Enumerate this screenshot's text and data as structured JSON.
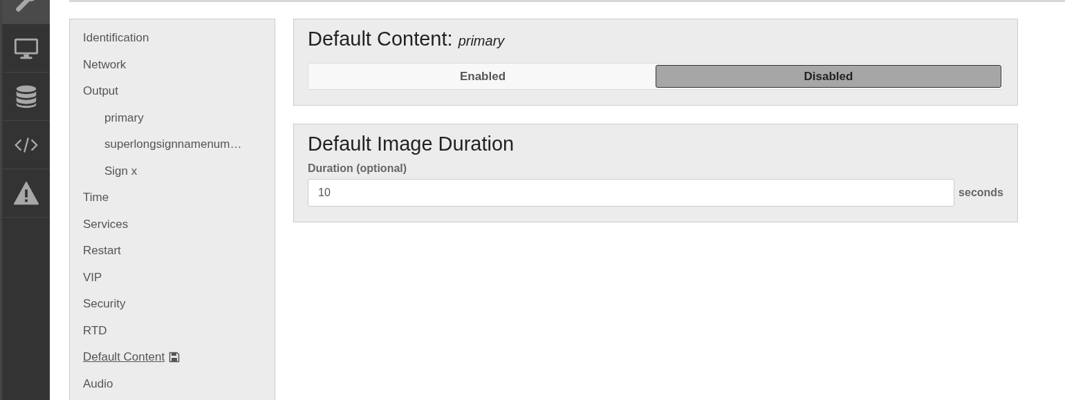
{
  "icon_bar": [
    {
      "kind": "wrench",
      "selected": true
    },
    {
      "kind": "monitor",
      "selected": false
    },
    {
      "kind": "database",
      "selected": false
    },
    {
      "kind": "code",
      "selected": false
    },
    {
      "kind": "warning",
      "selected": false
    }
  ],
  "sidebar": {
    "items": [
      {
        "label": "Identification",
        "selected": false
      },
      {
        "label": "Network",
        "selected": false
      },
      {
        "label": "Output",
        "selected": false,
        "children": [
          {
            "label": "primary",
            "selected": false
          },
          {
            "label": "superlongsignnamenum…",
            "selected": false
          },
          {
            "label": "Sign x",
            "selected": false
          }
        ]
      },
      {
        "label": "Time",
        "selected": false
      },
      {
        "label": "Services",
        "selected": false
      },
      {
        "label": "Restart",
        "selected": false
      },
      {
        "label": "VIP",
        "selected": false
      },
      {
        "label": "Security",
        "selected": false
      },
      {
        "label": "RTD",
        "selected": false
      },
      {
        "label": "Default Content",
        "selected": true,
        "unsaved": true
      },
      {
        "label": "Audio",
        "selected": false
      }
    ]
  },
  "default_content": {
    "title": "Default Content:",
    "subtitle": "primary",
    "options": [
      {
        "label": "Enabled",
        "selected": false
      },
      {
        "label": "Disabled",
        "selected": true
      }
    ]
  },
  "image_duration": {
    "title": "Default Image Duration",
    "field_label": "Duration (optional)",
    "value": "10",
    "unit": "seconds"
  }
}
